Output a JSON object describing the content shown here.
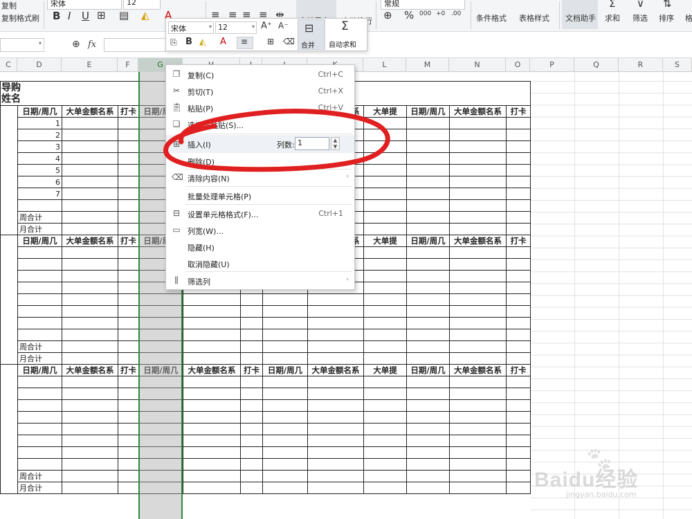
{
  "ribbon": {
    "copy_label": "复制",
    "format_painter_label": "格式刷",
    "font_name": "宋体",
    "font_size": "12",
    "merge_center_label": "合并居中",
    "wrap_text_label": "自动换行",
    "number_format": "常规",
    "conditional_format_label": "条件格式",
    "table_style_label": "表格样式",
    "doc_assistant_label": "文档助手",
    "sum_label": "求和",
    "filter_label": "筛选",
    "sort_label": "排序",
    "format_label": "格"
  },
  "formula_bar": {
    "fx_label": "fx",
    "name_box": ""
  },
  "columns": [
    "C",
    "D",
    "E",
    "F",
    "G",
    "H",
    "I",
    "J",
    "K",
    "L",
    "M",
    "N",
    "O",
    "P",
    "Q",
    "R",
    "S"
  ],
  "sheet": {
    "title_line1": "导购",
    "title_line2": "姓名",
    "headers": [
      "日期/周几",
      "大单金额名系",
      "打卡",
      "日期/周几",
      "大单金额名系",
      "打卡",
      "日期/周几",
      "大单金额名系",
      "大单提",
      "日期/周几",
      "大单金额名系",
      "打卡"
    ],
    "day_numbers": [
      "1",
      "2",
      "3",
      "4",
      "5",
      "6",
      "7"
    ],
    "week_total": "周合计",
    "month_total": "月合计"
  },
  "mini_toolbar": {
    "font_name": "宋体",
    "font_size": "12",
    "merge_label": "合并",
    "autosum_label": "自动求和"
  },
  "context_menu": {
    "copy": "复制(C)",
    "copy_sc": "Ctrl+C",
    "cut": "剪切(T)",
    "cut_sc": "Ctrl+X",
    "paste": "粘贴(P)",
    "paste_sc": "Ctrl+V",
    "paste_special": "选择性粘贴(S)...",
    "insert": "插入(I)",
    "insert_count_label": "列数:",
    "insert_count_value": "1",
    "delete": "删除(D)",
    "clear": "清除内容(N)",
    "batch": "批量处理单元格(P)",
    "format_cells": "设置单元格格式(F)...",
    "format_cells_sc": "Ctrl+1",
    "col_width": "列宽(W)...",
    "hide": "隐藏(H)",
    "unhide": "取消隐藏(U)",
    "filter_col": "筛选列"
  },
  "annotation": {
    "color": "#e02020"
  },
  "watermark": {
    "text": "Baidu经验",
    "url": "jingyan.baidu.com"
  },
  "colors": {
    "selected_col_border": "#2a8a3a",
    "selected_col_bg": "#d8d8d8",
    "ribbon_bg": "#f4f5f7"
  }
}
